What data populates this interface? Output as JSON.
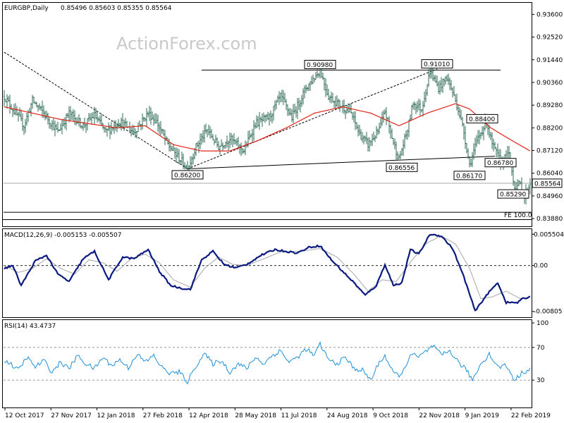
{
  "chart_data": [
    {
      "type": "line",
      "subtype": "ohlc-bars",
      "title": "EURGBP,Daily",
      "ohlc_header": "0.85496 0.85603 0.85355 0.85564",
      "watermark": "ActionForex.com",
      "ylim": [
        0.8385,
        0.9415
      ],
      "y_ticks": [
        "0.93600",
        "0.92520",
        "0.91440",
        "0.90360",
        "0.89280",
        "0.88200",
        "0.87120",
        "0.86040",
        "0.84960",
        "0.83880"
      ],
      "y_tick_values": [
        0.936,
        0.9252,
        0.9144,
        0.9036,
        0.8928,
        0.882,
        0.8712,
        0.8604,
        0.8496,
        0.8388
      ],
      "current_price": "0.85564",
      "current_price_value": 0.85564,
      "x_ticks": [
        "12 Oct 2017",
        "27 Nov 2017",
        "12 Jan 2018",
        "27 Feb 2018",
        "12 Apr 2018",
        "28 May 2018",
        "11 Jul 2018",
        "24 Aug 2018",
        "9 Oct 2018",
        "22 Nov 2018",
        "9 Jan 2019",
        "22 Feb 2019"
      ],
      "bar_count": 374,
      "close_anchors": [
        [
          0,
          0.897
        ],
        [
          4,
          0.893
        ],
        [
          14,
          0.883
        ],
        [
          20,
          0.895
        ],
        [
          28,
          0.889
        ],
        [
          38,
          0.88
        ],
        [
          46,
          0.889
        ],
        [
          56,
          0.883
        ],
        [
          64,
          0.888
        ],
        [
          72,
          0.88
        ],
        [
          82,
          0.885
        ],
        [
          92,
          0.88
        ],
        [
          102,
          0.889
        ],
        [
          108,
          0.885
        ],
        [
          116,
          0.874
        ],
        [
          126,
          0.866
        ],
        [
          130,
          0.8625
        ],
        [
          136,
          0.873
        ],
        [
          144,
          0.881
        ],
        [
          152,
          0.873
        ],
        [
          160,
          0.877
        ],
        [
          170,
          0.871
        ],
        [
          178,
          0.884
        ],
        [
          188,
          0.887
        ],
        [
          196,
          0.897
        ],
        [
          204,
          0.887
        ],
        [
          214,
          0.901
        ],
        [
          224,
          0.9095
        ],
        [
          230,
          0.897
        ],
        [
          238,
          0.893
        ],
        [
          246,
          0.889
        ],
        [
          252,
          0.879
        ],
        [
          258,
          0.874
        ],
        [
          266,
          0.881
        ],
        [
          270,
          0.89
        ],
        [
          276,
          0.875
        ],
        [
          280,
          0.867
        ],
        [
          286,
          0.881
        ],
        [
          290,
          0.894
        ],
        [
          296,
          0.891
        ],
        [
          302,
          0.909
        ],
        [
          308,
          0.901
        ],
        [
          314,
          0.906
        ],
        [
          318,
          0.899
        ],
        [
          322,
          0.891
        ],
        [
          326,
          0.88
        ],
        [
          330,
          0.8645
        ],
        [
          336,
          0.877
        ],
        [
          342,
          0.885
        ],
        [
          346,
          0.874
        ],
        [
          352,
          0.866
        ],
        [
          358,
          0.869
        ],
        [
          362,
          0.854
        ],
        [
          366,
          0.855
        ],
        [
          369,
          0.849
        ],
        [
          373,
          0.8556
        ]
      ],
      "moving_average": [
        [
          0,
          0.892
        ],
        [
          20,
          0.889
        ],
        [
          40,
          0.886
        ],
        [
          60,
          0.884
        ],
        [
          80,
          0.882
        ],
        [
          100,
          0.883
        ],
        [
          120,
          0.874
        ],
        [
          140,
          0.871
        ],
        [
          160,
          0.871
        ],
        [
          180,
          0.876
        ],
        [
          200,
          0.882
        ],
        [
          220,
          0.889
        ],
        [
          240,
          0.892
        ],
        [
          260,
          0.889
        ],
        [
          280,
          0.883
        ],
        [
          300,
          0.889
        ],
        [
          320,
          0.8935
        ],
        [
          330,
          0.891
        ],
        [
          345,
          0.882
        ],
        [
          360,
          0.876
        ],
        [
          373,
          0.871
        ]
      ],
      "trendlines": [
        {
          "name": "resistance",
          "points": [
            [
              140,
              0.9095
            ],
            [
              352,
              0.9095
            ]
          ]
        },
        {
          "name": "neckline",
          "points": [
            [
              130,
              0.8625
            ],
            [
              348,
              0.8685
            ]
          ]
        },
        {
          "name": "rising channel",
          "points": [
            [
              130,
              0.8625
            ],
            [
              307,
              0.91
            ]
          ]
        },
        {
          "name": "falling dashed",
          "points": [
            [
              0,
              0.918
            ],
            [
              130,
              0.8625
            ]
          ]
        },
        {
          "name": "fe level",
          "points": [
            [
              0,
              0.8418
            ],
            [
              373,
              0.8418
            ]
          ]
        }
      ],
      "annotations": [
        {
          "label": "0.90980",
          "bar": 224,
          "value": 0.9098
        },
        {
          "label": "0.91010",
          "bar": 307,
          "value": 0.9101
        },
        {
          "label": "0.88400",
          "bar": 339,
          "value": 0.884
        },
        {
          "label": "0.86200",
          "bar": 130,
          "value": 0.862
        },
        {
          "label": "0.86556",
          "bar": 282,
          "value": 0.86556
        },
        {
          "label": "0.86170",
          "bar": 330,
          "value": 0.8617
        },
        {
          "label": "0.86780",
          "bar": 352,
          "value": 0.8678
        },
        {
          "label": "0.85290",
          "bar": 361,
          "value": 0.8529
        }
      ],
      "fe_label": "FE 100.0"
    },
    {
      "type": "line",
      "title": "MACD(12,26,9) -0.005153 -0.005507",
      "ylim": [
        -0.0092,
        0.0064
      ],
      "y_ticks": [
        "0.005504",
        "0.00",
        "-0.00805"
      ],
      "y_tick_values": [
        0.0055,
        0.0,
        -0.00805
      ],
      "macd_anchors": [
        [
          0,
          -0.0005
        ],
        [
          6,
          0.0,
          0
        ],
        [
          12,
          -0.0035
        ],
        [
          22,
          0.0008
        ],
        [
          30,
          0.0018
        ],
        [
          38,
          -0.0015
        ],
        [
          46,
          -0.0028
        ],
        [
          56,
          0.0012
        ],
        [
          64,
          0.0025
        ],
        [
          74,
          -0.0025
        ],
        [
          84,
          0.0015
        ],
        [
          92,
          0.0012
        ],
        [
          102,
          0.0028
        ],
        [
          110,
          -0.001
        ],
        [
          118,
          -0.0035
        ],
        [
          126,
          -0.004
        ],
        [
          132,
          -0.0042
        ],
        [
          140,
          0.001
        ],
        [
          148,
          0.0025
        ],
        [
          156,
          0.0002
        ],
        [
          164,
          -0.0004
        ],
        [
          172,
          0.0002
        ],
        [
          182,
          0.0018
        ],
        [
          192,
          0.0028
        ],
        [
          200,
          0.0025
        ],
        [
          208,
          0.0022
        ],
        [
          216,
          0.0032
        ],
        [
          224,
          0.0035
        ],
        [
          232,
          0.001
        ],
        [
          240,
          -0.001
        ],
        [
          248,
          -0.003
        ],
        [
          256,
          -0.0052
        ],
        [
          264,
          -0.0035
        ],
        [
          270,
          0.0002
        ],
        [
          276,
          -0.0035
        ],
        [
          282,
          -0.003
        ],
        [
          288,
          0.0028
        ],
        [
          294,
          0.002
        ],
        [
          302,
          0.0055
        ],
        [
          310,
          0.0052
        ],
        [
          318,
          0.003
        ],
        [
          326,
          -0.002
        ],
        [
          334,
          -0.008
        ],
        [
          342,
          -0.0052
        ],
        [
          350,
          -0.003
        ],
        [
          356,
          -0.0065
        ],
        [
          364,
          -0.0065
        ],
        [
          368,
          -0.0058
        ],
        [
          373,
          -0.0055
        ]
      ],
      "signal_anchors": [
        [
          0,
          0.0
        ],
        [
          10,
          -0.0012
        ],
        [
          20,
          -0.0005
        ],
        [
          30,
          0.0012
        ],
        [
          40,
          -0.0005
        ],
        [
          50,
          -0.0015
        ],
        [
          60,
          0.001
        ],
        [
          70,
          0.0005
        ],
        [
          80,
          -0.001
        ],
        [
          90,
          0.0012
        ],
        [
          100,
          0.002
        ],
        [
          110,
          0.0005
        ],
        [
          120,
          -0.0025
        ],
        [
          132,
          -0.0038
        ],
        [
          142,
          -0.0005
        ],
        [
          152,
          0.0015
        ],
        [
          162,
          0.0002
        ],
        [
          172,
          0.0,
          0
        ],
        [
          184,
          0.0012
        ],
        [
          196,
          0.0024
        ],
        [
          210,
          0.0025
        ],
        [
          224,
          0.003
        ],
        [
          236,
          0.0015
        ],
        [
          248,
          -0.0015
        ],
        [
          258,
          -0.0045
        ],
        [
          268,
          -0.0025
        ],
        [
          278,
          -0.0028
        ],
        [
          290,
          0.0012
        ],
        [
          300,
          0.004
        ],
        [
          310,
          0.0052
        ],
        [
          320,
          0.0038
        ],
        [
          330,
          -0.0005
        ],
        [
          338,
          -0.0058
        ],
        [
          346,
          -0.0055
        ],
        [
          356,
          -0.0045
        ],
        [
          366,
          -0.0058
        ],
        [
          373,
          -0.0055
        ]
      ]
    },
    {
      "type": "line",
      "title": "RSI(14) 43.4737",
      "ylim": [
        0,
        100
      ],
      "y_ticks": [
        "100",
        "70",
        "30"
      ],
      "y_tick_values": [
        100,
        70,
        30
      ],
      "levels": [
        70,
        30
      ],
      "rsi_anchors": [
        [
          0,
          55
        ],
        [
          6,
          48
        ],
        [
          10,
          42
        ],
        [
          16,
          58
        ],
        [
          22,
          46
        ],
        [
          28,
          54
        ],
        [
          34,
          40
        ],
        [
          40,
          52
        ],
        [
          46,
          44
        ],
        [
          52,
          60
        ],
        [
          58,
          50
        ],
        [
          64,
          44
        ],
        [
          70,
          58
        ],
        [
          76,
          48
        ],
        [
          82,
          55
        ],
        [
          88,
          45
        ],
        [
          94,
          62
        ],
        [
          100,
          52
        ],
        [
          106,
          60
        ],
        [
          112,
          45
        ],
        [
          118,
          38
        ],
        [
          124,
          40
        ],
        [
          130,
          28
        ],
        [
          136,
          48
        ],
        [
          142,
          62
        ],
        [
          148,
          50
        ],
        [
          154,
          54
        ],
        [
          160,
          40
        ],
        [
          166,
          50
        ],
        [
          172,
          44
        ],
        [
          178,
          58
        ],
        [
          184,
          50
        ],
        [
          190,
          60
        ],
        [
          196,
          66
        ],
        [
          202,
          52
        ],
        [
          208,
          58
        ],
        [
          214,
          68
        ],
        [
          220,
          60
        ],
        [
          224,
          74
        ],
        [
          230,
          55
        ],
        [
          236,
          50
        ],
        [
          242,
          58
        ],
        [
          248,
          44
        ],
        [
          254,
          42
        ],
        [
          260,
          30
        ],
        [
          266,
          52
        ],
        [
          270,
          60
        ],
        [
          276,
          38
        ],
        [
          282,
          36
        ],
        [
          288,
          62
        ],
        [
          294,
          58
        ],
        [
          300,
          66
        ],
        [
          304,
          72
        ],
        [
          310,
          60
        ],
        [
          316,
          66
        ],
        [
          322,
          52
        ],
        [
          328,
          42
        ],
        [
          332,
          30
        ],
        [
          338,
          50
        ],
        [
          344,
          62
        ],
        [
          350,
          46
        ],
        [
          356,
          48
        ],
        [
          362,
          30
        ],
        [
          368,
          40
        ],
        [
          373,
          43.5
        ]
      ]
    }
  ]
}
